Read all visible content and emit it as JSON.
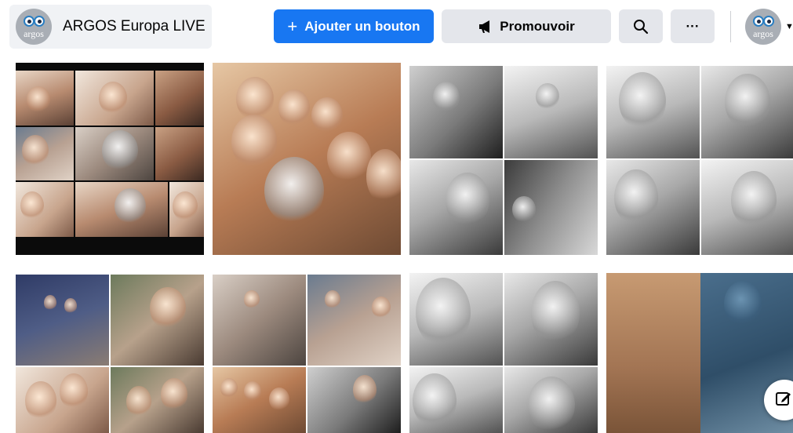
{
  "page": {
    "name": "ARGOS Europa LIVE",
    "logo_text": "argos"
  },
  "toolbar": {
    "add_button_label": "Ajouter un bouton",
    "promote_label": "Promouvoir",
    "more_label": "···"
  },
  "profile": {
    "logo_text": "argos"
  },
  "icons": {
    "plus": "plus-icon",
    "megaphone": "megaphone-icon",
    "search": "search-icon",
    "more": "more-horizontal-icon",
    "caret": "caret-down-icon",
    "edit": "edit-icon"
  },
  "colors": {
    "primary": "#1877f2",
    "button_grey": "#e4e6eb",
    "chip_bg": "#f0f2f5"
  }
}
